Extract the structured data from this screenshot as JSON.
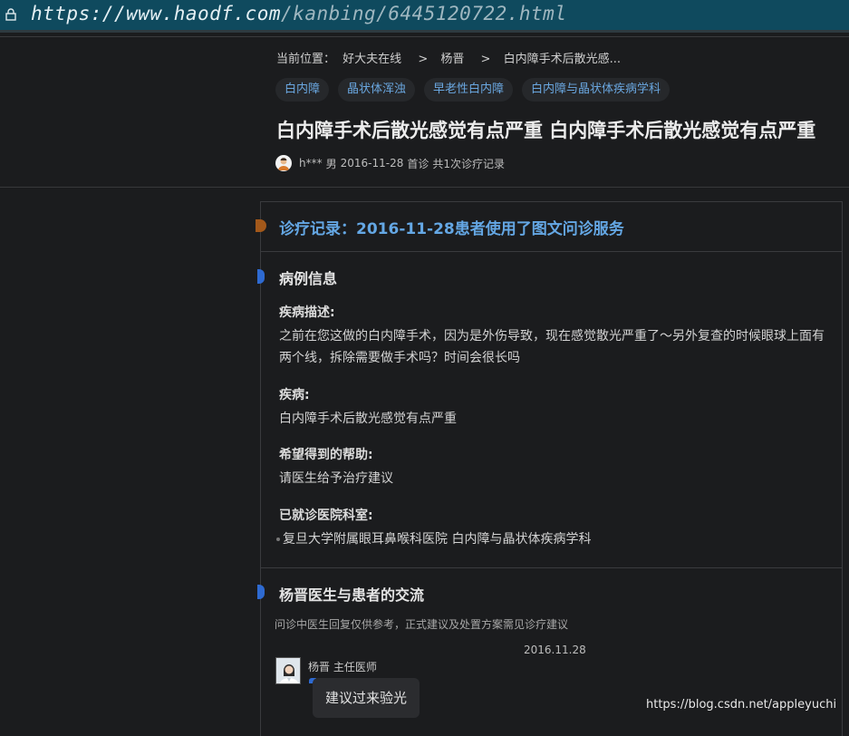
{
  "browser": {
    "url_prefix": "https://",
    "url_domain": "www.haodf.com",
    "url_path": "/kanbing/6445120722.html"
  },
  "breadcrumb": {
    "label": "当前位置：",
    "items": [
      "好大夫在线",
      "杨晋",
      "白内障手术后散光感..."
    ],
    "separator": ">"
  },
  "tags": [
    "白内障",
    "晶状体浑浊",
    "早老性白内障",
    "白内障与晶状体疾病学科"
  ],
  "page_title": "白内障手术后散光感觉有点严重 白内障手术后散光感觉有点严重",
  "meta": {
    "user": "h***",
    "gender": "男",
    "date": "2016-11-28",
    "visit_type": "首诊",
    "records": "共1次诊疗记录"
  },
  "record": {
    "title": "诊疗记录：2016-11-28患者使用了图文问诊服务",
    "case_section": "病例信息",
    "fields": [
      {
        "label": "疾病描述:",
        "value": "之前在您这做的白内障手术，因为是外伤导致，现在感觉散光严重了～另外复查的时候眼球上面有两个线，拆除需要做手术吗？时间会很长吗"
      },
      {
        "label": "疾病:",
        "value": "白内障手术后散光感觉有点严重"
      },
      {
        "label": "希望得到的帮助:",
        "value": "请医生给予治疗建议"
      },
      {
        "label": "已就诊医院科室:",
        "value": "复旦大学附属眼耳鼻喉科医院 白内障与晶状体疾病学科"
      }
    ],
    "exchange_section": "杨晋医生与患者的交流",
    "note": "问诊中医生回复仅供参考，正式建议及处置方案需见诊疗建议",
    "message": {
      "date": "2016.11.28",
      "doctor": "杨晋 主任医师",
      "text": "建议过来验光"
    }
  },
  "watermark": "https://blog.csdn.net/appleyuchi",
  "colors": {
    "url_bar": "#0f4a5e",
    "accent_blue": "#64a7e4",
    "tag_text": "#6aa7e0",
    "section_bar": "#2e6ad1",
    "record_dot": "#a2581a",
    "background": "#1b1c1e"
  }
}
